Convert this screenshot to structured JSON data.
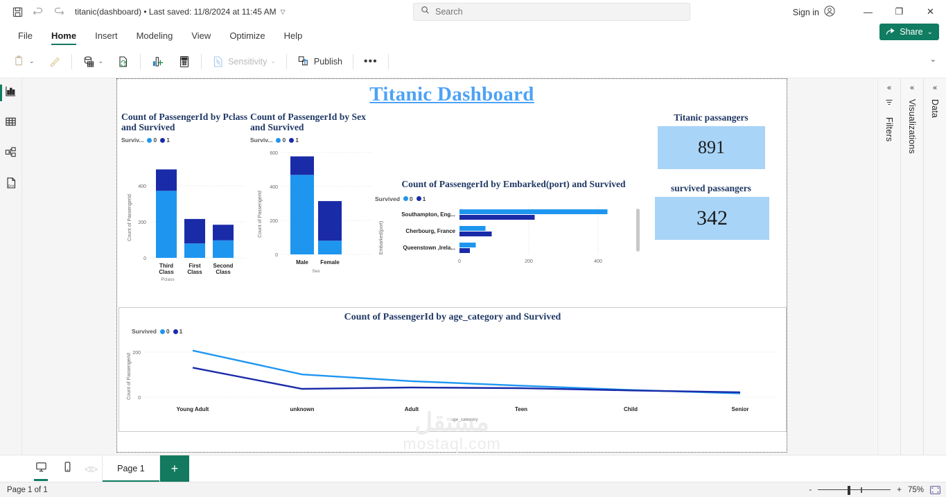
{
  "titlebar": {
    "save_icon": "save-icon",
    "undo_icon": "undo-icon",
    "redo_icon": "redo-icon",
    "document_title": "titanic(dashboard) • Last saved: 11/8/2024 at 11:45 AM",
    "title_caret": "▽",
    "search_placeholder": "Search",
    "signin_label": "Sign in",
    "minimize": "—",
    "restore": "❐",
    "close": "✕"
  },
  "ribbon": {
    "tabs": [
      {
        "label": "File",
        "active": false
      },
      {
        "label": "Home",
        "active": true
      },
      {
        "label": "Insert",
        "active": false
      },
      {
        "label": "Modeling",
        "active": false
      },
      {
        "label": "View",
        "active": false
      },
      {
        "label": "Optimize",
        "active": false
      },
      {
        "label": "Help",
        "active": false
      }
    ],
    "share_label": "Share",
    "share_caret": "⌄",
    "collapse_caret": "⌄"
  },
  "toolbar": {
    "items": [
      {
        "name": "paste-button",
        "label": "",
        "caret": "⌄",
        "disabled": true
      },
      {
        "name": "format-painter-button",
        "label": "",
        "caret": "",
        "disabled": true
      },
      {
        "name": "get-data-button",
        "label": "",
        "caret": "⌄",
        "disabled": false
      },
      {
        "name": "refresh-button",
        "label": "",
        "caret": "",
        "disabled": false
      },
      {
        "name": "new-visual-button",
        "label": "",
        "caret": "",
        "disabled": false
      },
      {
        "name": "new-measure-button",
        "label": "",
        "caret": "",
        "disabled": false
      },
      {
        "name": "sensitivity-button",
        "label": "Sensitivity",
        "caret": "⌄",
        "disabled": true
      },
      {
        "name": "publish-button",
        "label": "Publish",
        "caret": "",
        "disabled": false
      },
      {
        "name": "more-options-button",
        "label": "•••",
        "caret": "",
        "disabled": false
      }
    ]
  },
  "leftrail": {
    "items": [
      {
        "name": "report-view",
        "icon": "bar-chart-icon",
        "active": true
      },
      {
        "name": "table-view",
        "icon": "table-icon",
        "active": false
      },
      {
        "name": "model-view",
        "icon": "model-icon",
        "active": false
      },
      {
        "name": "dax-query-view",
        "icon": "dax-file-icon",
        "active": false
      }
    ]
  },
  "report": {
    "dashboard_title": "Titanic Dashboard",
    "watermark_arabic": "مستقل",
    "watermark_latin": "mostaql.com"
  },
  "chart_data": [
    {
      "id": "pclass",
      "type": "bar",
      "stacked": true,
      "title": "Count of PassengerId by Pclass and Survived",
      "legend_title": "Surviv...",
      "legend": [
        "0",
        "1"
      ],
      "legend_position": "top-left",
      "categories": [
        "Third Class",
        "First Class",
        "Second Class"
      ],
      "series": [
        {
          "name": "0",
          "color": "#1E96F0",
          "values": [
            372,
            80,
            97
          ]
        },
        {
          "name": "1",
          "color": "#1A2BA8",
          "values": [
            119,
            136,
            87
          ]
        }
      ],
      "xlabel": "Pclass",
      "ylabel": "Count of PassengerId",
      "yticks": [
        0,
        200,
        400
      ],
      "ylim": [
        0,
        520
      ],
      "grid": true
    },
    {
      "id": "sex",
      "type": "bar",
      "stacked": true,
      "title": "Count of PassengerId by Sex and Survived",
      "legend_title": "Surviv...",
      "legend": [
        "0",
        "1"
      ],
      "legend_position": "top-left",
      "categories": [
        "Male",
        "Female"
      ],
      "series": [
        {
          "name": "0",
          "color": "#1E96F0",
          "values": [
            468,
            81
          ]
        },
        {
          "name": "1",
          "color": "#1A2BA8",
          "values": [
            109,
            233
          ]
        }
      ],
      "xlabel": "Sex",
      "ylabel": "Count of PassengerId",
      "yticks": [
        0,
        200,
        400,
        600
      ],
      "ylim": [
        0,
        620
      ],
      "grid": true
    },
    {
      "id": "embarked",
      "type": "bar",
      "orientation": "horizontal",
      "stacked": false,
      "title": "Count of PassengerId by Embarked(port) and Survived",
      "legend_title": "Survived",
      "legend": [
        "0",
        "1"
      ],
      "legend_position": "top-left",
      "categories": [
        "Southampton, Eng...",
        "Cherbourg, France",
        "Queenstown ,Irela..."
      ],
      "series": [
        {
          "name": "0",
          "color": "#1E96F0",
          "values": [
            427,
            75,
            47
          ]
        },
        {
          "name": "1",
          "color": "#1A2BA8",
          "values": [
            217,
            93,
            30
          ]
        }
      ],
      "xlabel": "",
      "ylabel": "Embarked(port)",
      "xticks": [
        0,
        200,
        400
      ],
      "xlim": [
        0,
        460
      ],
      "grid": true
    },
    {
      "id": "age_category",
      "type": "line",
      "title": "Count of PassengerId by age_category and Survived",
      "legend_title": "Survived",
      "legend": [
        "0",
        "1"
      ],
      "legend_position": "top-left",
      "categories": [
        "Young Adult",
        "unknown",
        "Adult",
        "Teen",
        "Child",
        "Senior"
      ],
      "series": [
        {
          "name": "0",
          "color": "#1E96F0",
          "values": [
            207,
            101,
            71,
            51,
            32,
            17
          ]
        },
        {
          "name": "1",
          "color": "#1A2BA8",
          "values": [
            131,
            37,
            43,
            40,
            30,
            22
          ]
        }
      ],
      "xlabel": "age_category",
      "ylabel": "Count of PassengerId",
      "yticks": [
        0,
        200
      ],
      "ylim": [
        0,
        260
      ],
      "grid": true
    }
  ],
  "cards": [
    {
      "id": "total-passengers",
      "title": "Titanic passangers",
      "value": "891"
    },
    {
      "id": "survived-passengers",
      "title": "survived passangers",
      "value": "342"
    }
  ],
  "rightpanes": [
    {
      "name": "filters-pane",
      "label": "Filters",
      "chevron": "«",
      "icon": "filter-icon"
    },
    {
      "name": "visualizations-pane",
      "label": "Visualizations",
      "chevron": "«",
      "icon": ""
    },
    {
      "name": "data-pane",
      "label": "Data",
      "chevron": "«",
      "icon": ""
    }
  ],
  "bottombar": {
    "desktop_view_icon": "monitor-icon",
    "mobile_view_icon": "phone-icon",
    "prev_page_icon": "◁",
    "next_page_icon": "▷",
    "page_tab_label": "Page 1",
    "add_page_label": "+"
  },
  "statusbar": {
    "page_status": "Page 1 of 1",
    "zoom_out": "-",
    "zoom_in": "+",
    "zoom_level": "75%",
    "fit_icon": "fit-to-page-icon"
  }
}
